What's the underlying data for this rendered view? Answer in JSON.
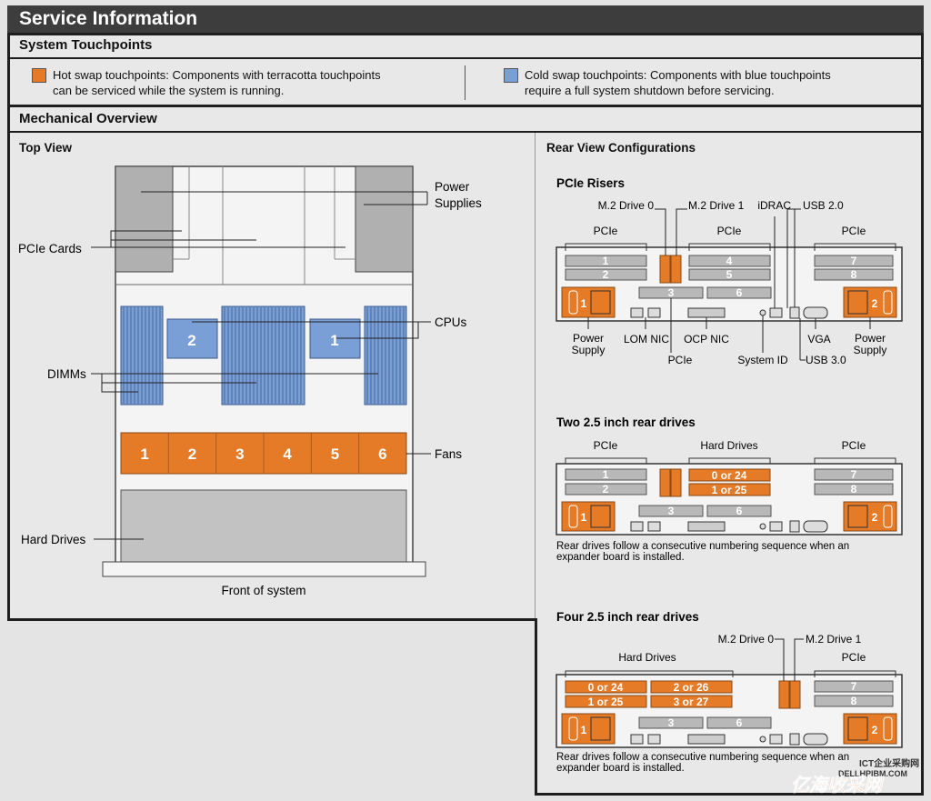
{
  "header": {
    "title": "Service Information"
  },
  "touchpoints": {
    "title": "System Touchpoints",
    "hot": {
      "color": "#e57a27",
      "line1": "Hot swap touchpoints: Components with terracotta touchpoints",
      "line2": "can be serviced while the system is running."
    },
    "cold": {
      "color": "#7a9fd6",
      "line1": "Cold swap touchpoints: Components with blue touchpoints",
      "line2": "require a full system shutdown before servicing."
    }
  },
  "mechanical": {
    "title": "Mechanical Overview",
    "top_view": {
      "title": "Top View",
      "labels": {
        "power_supplies_1": "Power",
        "power_supplies_2": "Supplies",
        "pcie_cards": "PCIe Cards",
        "cpus": "CPUs",
        "dimms": "DIMMs",
        "fans": "Fans",
        "hard_drives": "Hard Drives",
        "front": "Front of system"
      },
      "cpus": [
        "2",
        "1"
      ],
      "fans": [
        "1",
        "2",
        "3",
        "4",
        "5",
        "6"
      ]
    },
    "rear_view": {
      "title": "Rear View Configurations",
      "pcie_risers": {
        "title": "PCIe Risers",
        "labels": {
          "m2_drive_0": "M.2 Drive 0",
          "m2_drive_1": "M.2 Drive 1",
          "idrac": "iDRAC",
          "usb_2": "USB 2.0",
          "pcie": "PCIe",
          "power_supply_1": "Power",
          "power_supply_2": "Supply",
          "lom_nic": "LOM NIC",
          "ocp_nic": "OCP NIC",
          "system_id": "System ID",
          "vga": "VGA",
          "usb_3": "USB 3.0"
        },
        "slots": [
          "1",
          "2",
          "3",
          "4",
          "5",
          "6",
          "7",
          "8"
        ],
        "psus": [
          "1",
          "2"
        ]
      },
      "two_drives": {
        "title": "Two 2.5 inch rear drives",
        "labels": {
          "pcie": "PCIe",
          "hard_drives": "Hard Drives"
        },
        "drives": [
          "0 or 24",
          "1 or 25"
        ],
        "note_1": "Rear drives follow a consecutive numbering sequence when an",
        "note_2": "expander board is installed."
      },
      "four_drives": {
        "title": "Four 2.5 inch rear drives",
        "labels": {
          "m2_drive_0": "M.2 Drive 0",
          "m2_drive_1": "M.2 Drive 1",
          "hard_drives": "Hard Drives",
          "pcie": "PCIe"
        },
        "drives": [
          "0 or 24",
          "2 or 26",
          "1 or 25",
          "3 or 27"
        ],
        "note_1": "Rear drives follow a consecutive numbering sequence when an",
        "note_2": "expander board is installed."
      }
    }
  },
  "watermark": {
    "text_1": "ICT企业采购网",
    "text_2": "DELLHPIBM.COM",
    "text_3": "亿海收采网"
  },
  "colors": {
    "orange": "#e57a27",
    "blue": "#7a9fd6",
    "gray": "#bdbdbd",
    "dark": "#1e1e1e"
  }
}
